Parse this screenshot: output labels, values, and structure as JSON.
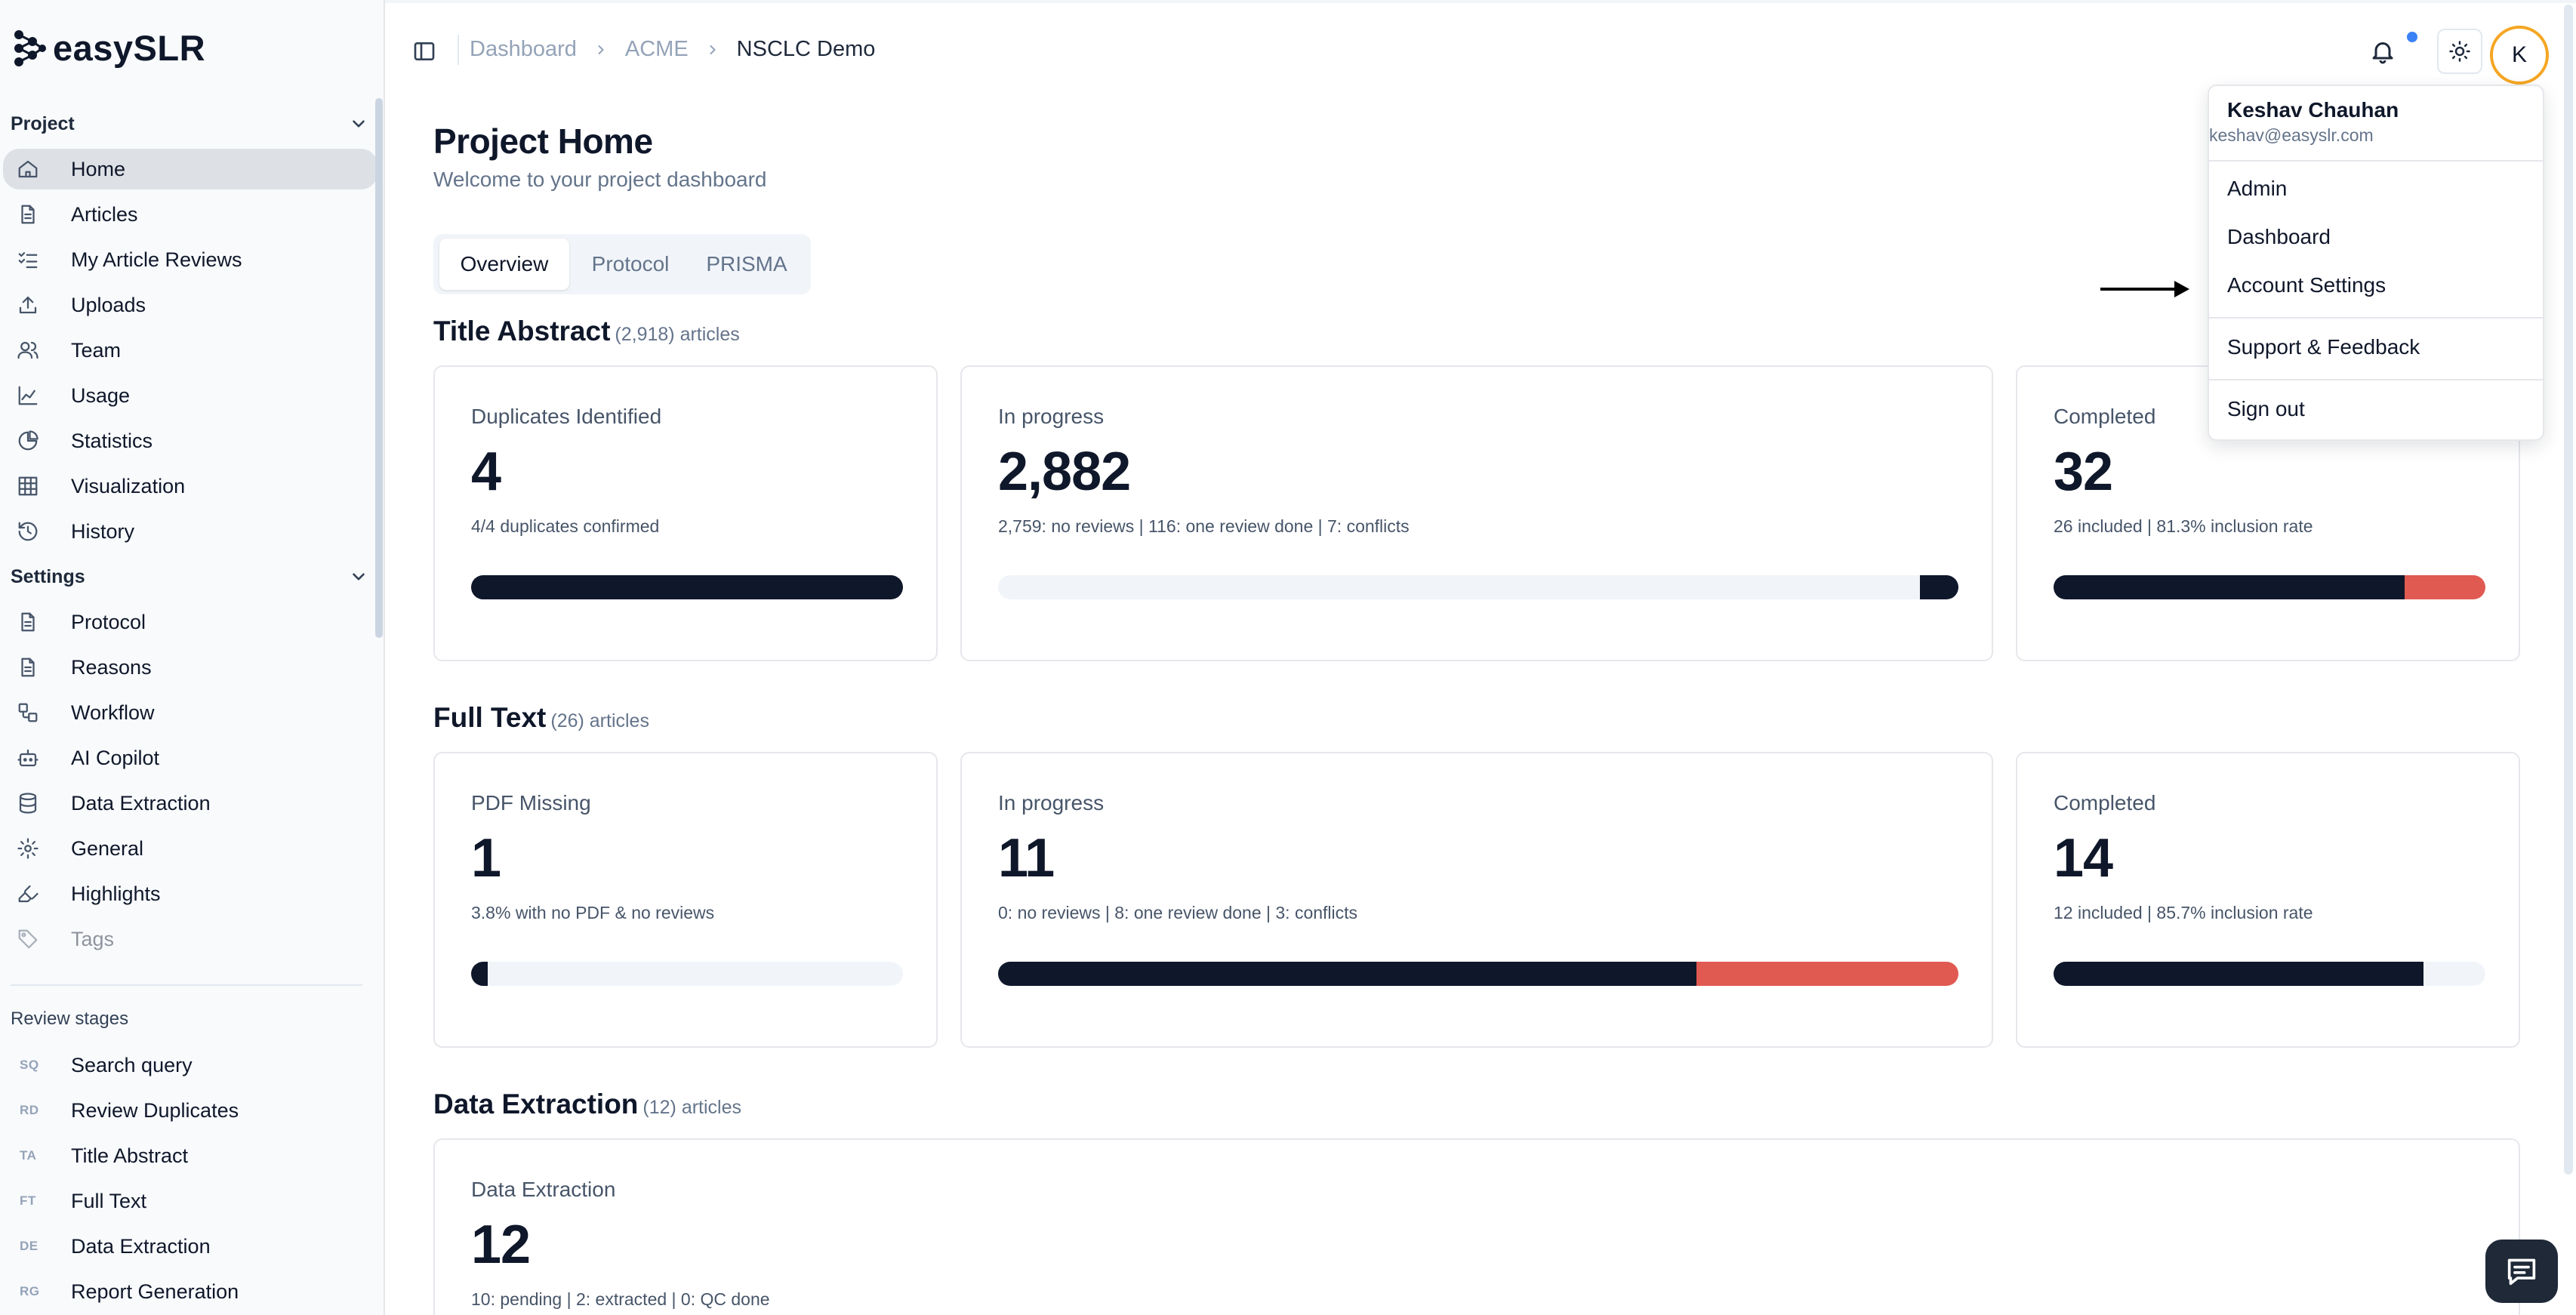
{
  "app": {
    "name": "easySLR"
  },
  "colors": {
    "dark": "#0f172a",
    "red": "#e05a52",
    "track": "#f1f5f9",
    "accent": "#f5a623",
    "notify": "#3b82f6"
  },
  "sidebar": {
    "project_section": "Project",
    "project_items": [
      {
        "label": "Home",
        "icon": "home-icon",
        "active": true
      },
      {
        "label": "Articles",
        "icon": "file-icon"
      },
      {
        "label": "My Article Reviews",
        "icon": "checklist-icon"
      },
      {
        "label": "Uploads",
        "icon": "upload-icon"
      },
      {
        "label": "Team",
        "icon": "users-icon"
      },
      {
        "label": "Usage",
        "icon": "line-chart-icon"
      },
      {
        "label": "Statistics",
        "icon": "pie-chart-icon"
      },
      {
        "label": "Visualization",
        "icon": "grid-icon"
      },
      {
        "label": "History",
        "icon": "history-icon"
      }
    ],
    "settings_section": "Settings",
    "settings_items": [
      {
        "label": "Protocol",
        "icon": "file-icon"
      },
      {
        "label": "Reasons",
        "icon": "file-icon"
      },
      {
        "label": "Workflow",
        "icon": "workflow-icon"
      },
      {
        "label": "AI Copilot",
        "icon": "bot-icon"
      },
      {
        "label": "Data Extraction",
        "icon": "database-icon"
      },
      {
        "label": "General",
        "icon": "gear-icon"
      },
      {
        "label": "Highlights",
        "icon": "highlighter-icon"
      },
      {
        "label": "Tags",
        "icon": "tag-icon"
      }
    ],
    "review_section": "Review stages",
    "review_items": [
      {
        "abbr": "SQ",
        "label": "Search query"
      },
      {
        "abbr": "RD",
        "label": "Review Duplicates"
      },
      {
        "abbr": "TA",
        "label": "Title Abstract"
      },
      {
        "abbr": "FT",
        "label": "Full Text"
      },
      {
        "abbr": "DE",
        "label": "Data Extraction"
      },
      {
        "abbr": "RG",
        "label": "Report Generation"
      }
    ]
  },
  "header": {
    "breadcrumb": [
      "Dashboard",
      "ACME",
      "NSCLC Demo"
    ],
    "avatar_initial": "K"
  },
  "main": {
    "title": "Project Home",
    "subtitle": "Welcome to your project dashboard",
    "tabs": [
      "Overview",
      "Protocol",
      "PRISMA"
    ],
    "sections": [
      {
        "title": "Title Abstract",
        "count": "(2,918) articles",
        "cards": [
          {
            "label": "Duplicates Identified",
            "value": "4",
            "detail": "4/4 duplicates confirmed",
            "progress": [
              {
                "fraction": 1.0,
                "color": "dark"
              }
            ]
          },
          {
            "label": "In progress",
            "value": "2,882",
            "detail": "2,759: no reviews | 116: one review done | 7: conflicts",
            "progress": [
              {
                "fraction": 0.04,
                "color": "dark",
                "align": "end"
              }
            ]
          },
          {
            "label": "Completed",
            "value": "32",
            "detail": "26 included | 81.3% inclusion rate",
            "progress": [
              {
                "fraction": 0.813,
                "color": "dark"
              },
              {
                "fraction": 0.187,
                "color": "red"
              }
            ]
          }
        ]
      },
      {
        "title": "Full Text",
        "count": "(26) articles",
        "cards": [
          {
            "label": "PDF Missing",
            "value": "1",
            "detail": "3.8% with no PDF & no reviews",
            "progress": [
              {
                "fraction": 0.038,
                "color": "dark"
              }
            ]
          },
          {
            "label": "In progress",
            "value": "11",
            "detail": "0: no reviews | 8: one review done | 3: conflicts",
            "progress": [
              {
                "fraction": 0.727,
                "color": "dark"
              },
              {
                "fraction": 0.273,
                "color": "red"
              }
            ]
          },
          {
            "label": "Completed",
            "value": "14",
            "detail": "12 included | 85.7% inclusion rate",
            "progress": [
              {
                "fraction": 0.857,
                "color": "dark"
              }
            ]
          }
        ]
      },
      {
        "title": "Data Extraction",
        "count": "(12) articles",
        "cards": [
          {
            "label": "Data Extraction",
            "value": "12",
            "detail": "10: pending | 2: extracted | 0: QC done"
          }
        ]
      }
    ]
  },
  "user_menu": {
    "name": "Keshav Chauhan",
    "email": "keshav@easyslr.com",
    "items": [
      "Admin",
      "Dashboard",
      "Account Settings",
      "Support & Feedback",
      "Sign out"
    ]
  }
}
